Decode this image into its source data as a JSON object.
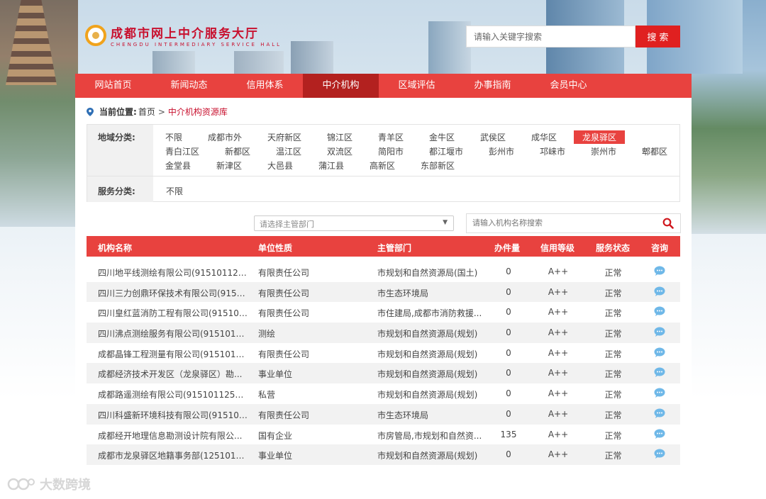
{
  "header": {
    "logo_cn": "成都市网上中介服务大厅",
    "logo_en": "CHENGDU INTERMEDIARY SERVICE HALL",
    "search_placeholder": "请输入关键字搜索",
    "search_button": "搜 索"
  },
  "nav": {
    "items": [
      "网站首页",
      "新闻动态",
      "信用体系",
      "中介机构",
      "区域评估",
      "办事指南",
      "会员中心"
    ],
    "active_index": 3
  },
  "breadcrumb": {
    "label": "当前位置:",
    "home": "首页",
    "separator": ">",
    "current": "中介机构资源库"
  },
  "filters": {
    "region_label": "地域分类:",
    "regions": [
      "不限",
      "成都市外",
      "天府新区",
      "锦江区",
      "青羊区",
      "金牛区",
      "武侯区",
      "成华区",
      "龙泉驿区",
      "青白江区",
      "新都区",
      "温江区",
      "双流区",
      "简阳市",
      "都江堰市",
      "彭州市",
      "邛崃市",
      "崇州市",
      "郫都区",
      "金堂县",
      "新津区",
      "大邑县",
      "蒲江县",
      "高新区",
      "东部新区"
    ],
    "active_region": "龙泉驿区",
    "service_label": "服务分类:",
    "service_value": "不限"
  },
  "search": {
    "dept_placeholder": "请选择主管部门",
    "name_placeholder": "请输入机构名称搜索"
  },
  "table": {
    "headers": [
      "机构名称",
      "单位性质",
      "主管部门",
      "办件量",
      "信用等级",
      "服务状态",
      "咨询"
    ],
    "rows": [
      [
        "四川地平线测绘有限公司(9151011267...",
        "有限责任公司",
        "市规划和自然资源局(国土)",
        "0",
        "A++",
        "正常"
      ],
      [
        "四川三力创鼎环保技术有限公司(9151...",
        "有限责任公司",
        "市生态环境局",
        "0",
        "A++",
        "正常"
      ],
      [
        "四川皇红蓝消防工程有限公司(915101...",
        "有限责任公司",
        "市住建局,成都市消防救援...",
        "0",
        "A++",
        "正常"
      ],
      [
        "四川沸点测绘服务有限公司(91510112...",
        "测绘",
        "市规划和自然资源局(规划)",
        "0",
        "A++",
        "正常"
      ],
      [
        "成都晶锋工程测量有限公司(91510112...",
        "有限责任公司",
        "市规划和自然资源局(规划)",
        "0",
        "A++",
        "正常"
      ],
      [
        "成都经济技术开发区（龙泉驿区）勘...",
        "事业单位",
        "市规划和自然资源局(规划)",
        "0",
        "A++",
        "正常"
      ],
      [
        "成都路遥测绘有限公司(91510112597...",
        "私营",
        "市规划和自然资源局(规划)",
        "0",
        "A++",
        "正常"
      ],
      [
        "四川科盛新环境科技有限公司(915101...",
        "有限责任公司",
        "市生态环境局",
        "0",
        "A++",
        "正常"
      ],
      [
        "成都经开地理信息勘测设计院有限公...",
        "国有企业",
        "市房管局,市规划和自然资...",
        "135",
        "A++",
        "正常"
      ],
      [
        "成都市龙泉驿区地籍事务部(12510112...",
        "事业单位",
        "市规划和自然资源局(规划)",
        "0",
        "A++",
        "正常"
      ]
    ]
  },
  "watermark": "大数跨境",
  "colors": {
    "primary": "#e8423f",
    "nav_active": "#b3211f",
    "link_red": "#c8102e",
    "chat_icon": "#6fb8e8"
  }
}
